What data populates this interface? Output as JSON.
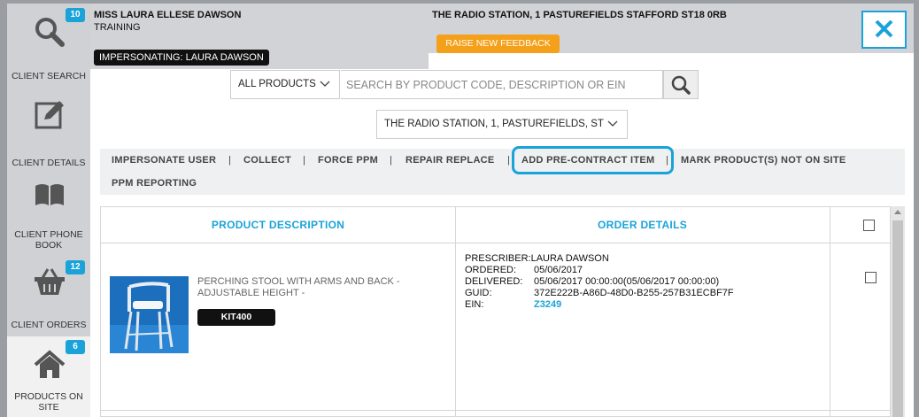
{
  "sidebar": {
    "items": [
      {
        "label": "CLIENT SEARCH",
        "badge": "10",
        "icon": "search-icon"
      },
      {
        "label": "CLIENT DETAILS",
        "badge": "",
        "icon": "edit-icon"
      },
      {
        "label": "CLIENT PHONE BOOK",
        "badge": "",
        "icon": "book-icon"
      },
      {
        "label": "CLIENT ORDERS",
        "badge": "12",
        "icon": "basket-icon"
      },
      {
        "label": "PRODUCTS ON SITE",
        "badge": "6",
        "icon": "home-icon"
      }
    ]
  },
  "header": {
    "client_name": "MISS LAURA ELLESE DAWSON",
    "client_sub": "TRAINING",
    "impersonating": "IMPERSONATING: LAURA DAWSON",
    "address": "THE RADIO STATION, 1 PASTUREFIELDS STAFFORD ST18 0RB",
    "feedback_label": "RAISE NEW FEEDBACK"
  },
  "search": {
    "product_filter": "ALL PRODUCTS",
    "placeholder": "SEARCH BY PRODUCT CODE, DESCRIPTION OR EIN",
    "address_select": "THE RADIO STATION, 1, PASTUREFIELDS, ST"
  },
  "actions": {
    "impersonate": "IMPERSONATE USER",
    "collect": "COLLECT",
    "force_ppm": "FORCE PPM",
    "repair_replace": "REPAIR REPLACE",
    "add_pre_contract": "ADD PRE-CONTRACT ITEM",
    "mark_not_on_site": "MARK PRODUCT(S) NOT ON SITE",
    "ppm_reporting": "PPM REPORTING",
    "separator": "|"
  },
  "table": {
    "col_product": "PRODUCT DESCRIPTION",
    "col_order": "ORDER DETAILS",
    "rows": [
      {
        "description": "PERCHING STOOL WITH ARMS AND BACK - ADJUSTABLE HEIGHT -",
        "code": "KIT400",
        "prescriber_label": "PRESCRIBER:",
        "prescriber": "LAURA DAWSON",
        "ordered_label": "ORDERED:",
        "ordered": "05/06/2017",
        "delivered_label": "DELIVERED:",
        "delivered": "05/06/2017 00:00:00(05/06/2017 00:00:00)",
        "guid_label": "GUID:",
        "guid": "372E222B-A86D-48D0-B255-257B31ECBF7F",
        "ein_label": "EIN:",
        "ein": "Z3249"
      }
    ]
  }
}
